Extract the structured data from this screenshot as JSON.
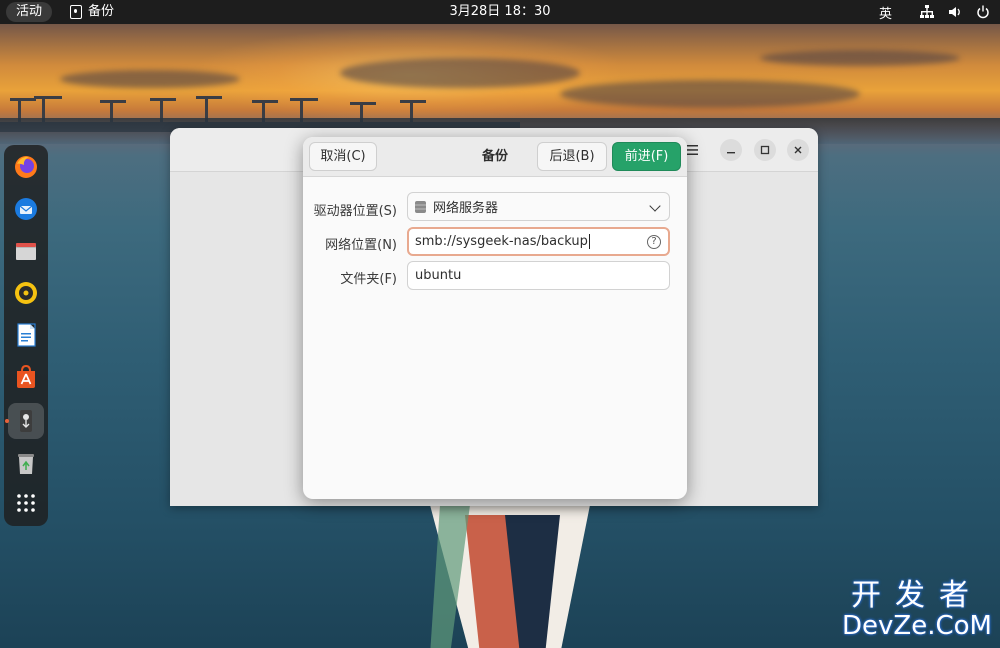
{
  "topbar": {
    "activities_label": "活动",
    "app_name": "备份",
    "clock": "3月28日 18：30",
    "input_method": "英",
    "icons": [
      "network-icon",
      "volume-icon",
      "power-icon"
    ]
  },
  "dock": {
    "items": [
      {
        "name": "firefox",
        "icon": "firefox-icon"
      },
      {
        "name": "thunderbird",
        "icon": "thunderbird-icon"
      },
      {
        "name": "files",
        "icon": "files-icon"
      },
      {
        "name": "rhythmbox",
        "icon": "rhythmbox-icon"
      },
      {
        "name": "writer",
        "icon": "libreoffice-writer-icon"
      },
      {
        "name": "app-center",
        "icon": "app-center-icon"
      },
      {
        "name": "deja-dup-backup",
        "icon": "backup-icon",
        "active": true
      },
      {
        "name": "trash",
        "icon": "trash-icon"
      },
      {
        "name": "show-apps",
        "icon": "app-grid-icon"
      }
    ]
  },
  "dialog": {
    "title": "备份",
    "cancel_label": "取消(C)",
    "back_label": "后退(B)",
    "forward_label": "前进(F)",
    "storage_label": "驱动器位置(S)",
    "storage_value": "网络服务器",
    "network_label": "网络位置(N)",
    "network_value": "smb://sysgeek-nas/backup",
    "folder_label": "文件夹(F)",
    "folder_value": "ubuntu",
    "help_glyph": "?"
  },
  "watermark": {
    "cn": "开发者",
    "en": "DevZe.CoM"
  },
  "colors": {
    "primary_button": "#26a269",
    "focus_border": "#e8a98f",
    "topbar": "#1d1d1d"
  }
}
